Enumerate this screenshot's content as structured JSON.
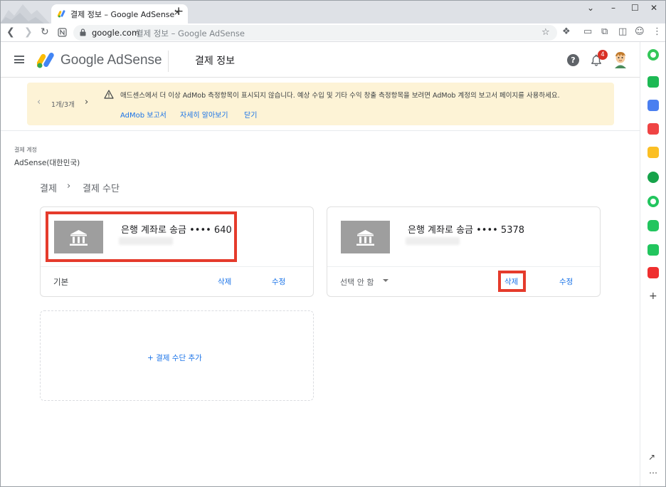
{
  "browser": {
    "tab_title": "결제 정보 – Google AdSense",
    "tab_close": "×",
    "new_tab": "+",
    "url_host": "google.com",
    "url_rest": "결제 정보 – Google AdSense",
    "win_controls": [
      "⌄",
      "–",
      "☐",
      "✕"
    ]
  },
  "header": {
    "brand": "Google AdSense",
    "title": "결제 정보",
    "help": "?",
    "notification_count": "4"
  },
  "banner": {
    "pager": "1개/3개",
    "message": "애드센스에서 더 이상 AdMob 측정항목이 표시되지 않습니다. 예상 수입 및 기타 수익 창출 측정항목을 보려면 AdMob 계정의 보고서 페이지를 사용하세요.",
    "links": [
      "AdMob 보고서",
      "자세히 알아보기",
      "닫기"
    ]
  },
  "account": {
    "label": "결제 계정",
    "name": "AdSense(대한민국)"
  },
  "breadcrumb": {
    "parent": "결제",
    "separator": "›",
    "current": "결제 수단"
  },
  "payment_methods": [
    {
      "name": "은행 계좌로 송금 •••• 640",
      "status": "기본",
      "delete_label": "삭제",
      "edit_label": "수정"
    },
    {
      "name": "은행 계좌로 송금 •••• 5378",
      "status": "선택 안 함",
      "delete_label": "삭제",
      "edit_label": "수정"
    }
  ],
  "add_payment": "+ 결제 수단 추가",
  "colors": {
    "accent": "#1a73e8",
    "highlight": "#e53b2c",
    "banner_bg": "#fdf3d6",
    "bank_icon_bg": "#9e9e9e"
  }
}
